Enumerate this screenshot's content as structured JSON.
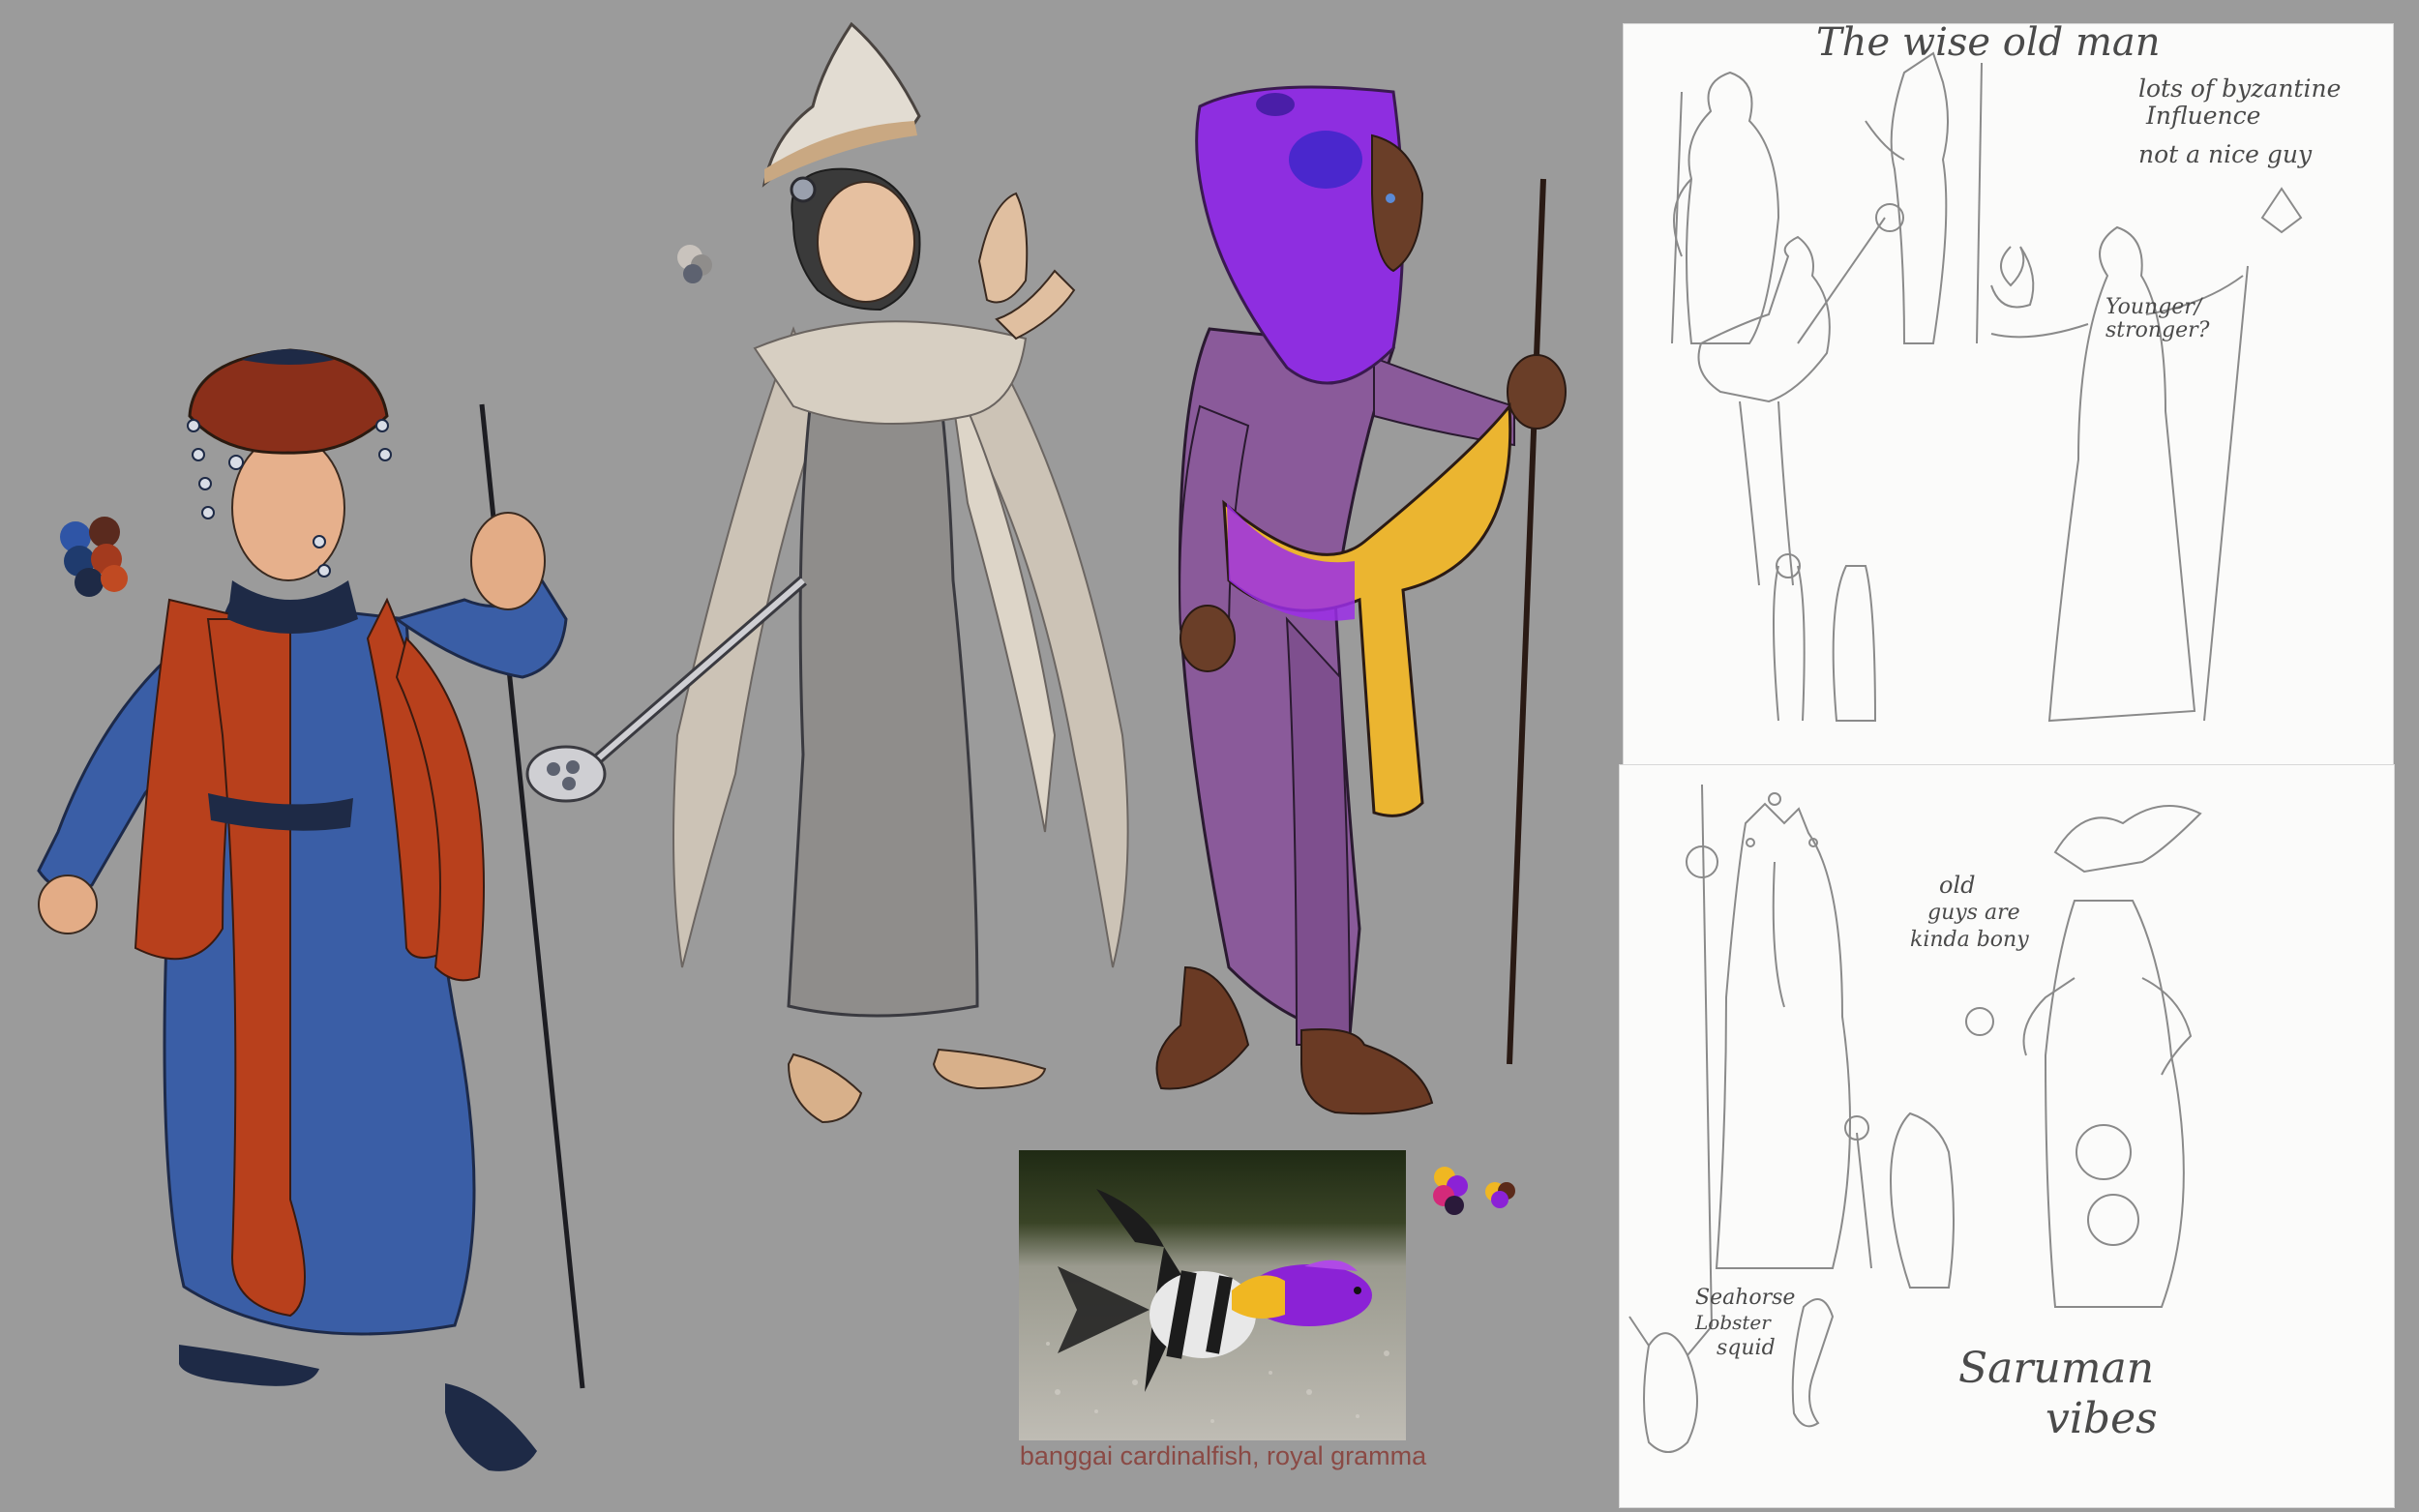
{
  "sketch_top": {
    "title": "The wise old man",
    "note1": "lots of byzantine",
    "note1b": "Influence",
    "note2": "not a nice guy",
    "note3": "Younger/",
    "note3b": "stronger?"
  },
  "sketch_bottom": {
    "note1": "old",
    "note1b": "guys are",
    "note1c": "kinda bony",
    "note2": "Seahorse",
    "note2b": "Lobster",
    "note2c": "squid",
    "note3": "Saruman",
    "note3b": "vibes"
  },
  "reference_photo": {
    "caption": "banggai cardinalfish, royal gramma"
  },
  "palettes": {
    "wizard_old": [
      "#2f55a6",
      "#5a2a1e",
      "#a33a1e",
      "#1f3b6e",
      "#c04a22"
    ],
    "wizard_white": [
      "#c9c3bd",
      "#8f8d8b",
      "#5d6270"
    ],
    "wizard_purple": [
      "#f0b722",
      "#8b22d6",
      "#2a1a3a",
      "#d42a7a",
      "#5b2a1a"
    ]
  },
  "colors": {
    "background": "#9b9b9b",
    "robe_blue": "#3a5ea6",
    "robe_red": "#b8401c",
    "cloak_beige": "#cfc6b8",
    "hood_purple": "#8e2ee0",
    "suit_purple": "#8a5a9a",
    "scarf_yellow": "#ebb530"
  }
}
